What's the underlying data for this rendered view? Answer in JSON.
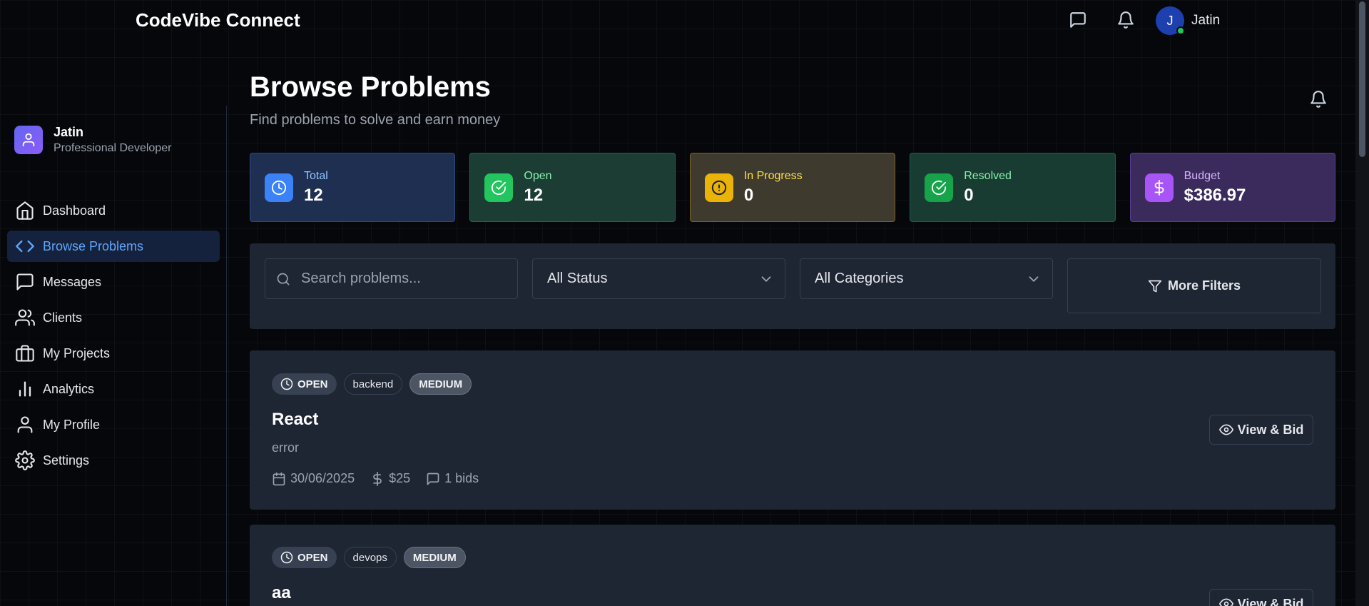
{
  "header": {
    "brand": "CodeVibe Connect",
    "user_initial": "J",
    "user_name": "Jatin"
  },
  "sidebar": {
    "profile": {
      "name": "Jatin",
      "role": "Professional Developer"
    },
    "items": [
      {
        "label": "Dashboard",
        "icon": "home-icon"
      },
      {
        "label": "Browse Problems",
        "icon": "code-icon",
        "active": true
      },
      {
        "label": "Messages",
        "icon": "message-icon"
      },
      {
        "label": "Clients",
        "icon": "users-icon"
      },
      {
        "label": "My Projects",
        "icon": "briefcase-icon"
      },
      {
        "label": "Analytics",
        "icon": "bar-chart-icon"
      },
      {
        "label": "My Profile",
        "icon": "user-icon"
      },
      {
        "label": "Settings",
        "icon": "gear-icon"
      }
    ]
  },
  "page": {
    "title": "Browse Problems",
    "subtitle": "Find problems to solve and earn money"
  },
  "stats": [
    {
      "label": "Total",
      "value": "12",
      "icon": "clock-icon",
      "color": "#3b82f6"
    },
    {
      "label": "Open",
      "value": "12",
      "icon": "check-circle-icon",
      "color": "#22c55e"
    },
    {
      "label": "In Progress",
      "value": "0",
      "icon": "alert-circle-icon",
      "color": "#eab308"
    },
    {
      "label": "Resolved",
      "value": "0",
      "icon": "check-circle-icon",
      "color": "#16a34a"
    },
    {
      "label": "Budget",
      "value": "$386.97",
      "icon": "dollar-icon",
      "color": "#a855f7"
    }
  ],
  "filters": {
    "search_placeholder": "Search problems...",
    "status": "All Status",
    "category": "All Categories",
    "more_filters": "More Filters"
  },
  "problems": [
    {
      "status": "OPEN",
      "category": "backend",
      "priority": "MEDIUM",
      "title": "React",
      "description": "error",
      "date": "30/06/2025",
      "budget": "$25",
      "bids": "1 bids",
      "action": "View & Bid"
    },
    {
      "status": "OPEN",
      "category": "devops",
      "priority": "MEDIUM",
      "title": "aa",
      "action": "View & Bid"
    }
  ]
}
